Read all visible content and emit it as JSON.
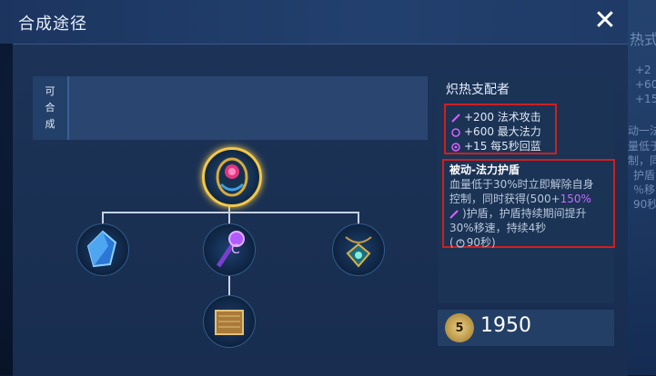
{
  "header": {
    "title": "合成途径",
    "close_symbol": "✕"
  },
  "craft": {
    "label": [
      "可",
      "合",
      "成"
    ]
  },
  "bg_text": {
    "right_top": "热式",
    "right_nums": [
      "+2",
      "+60",
      "+15"
    ],
    "right_mid": [
      "动一法",
      "量低于",
      "制，同",
      "护盾",
      "％移",
      "90秒"
    ]
  },
  "item": {
    "name": "炽热支配者",
    "stats": [
      "+200 法术攻击",
      "+600 最大法力",
      "+15 每5秒回蓝"
    ],
    "passive_title": "被动-法力护盾",
    "passive_lines": [
      "血量低于30%时立即解除自身",
      "控制，同时获得(500+",
      "150%",
      ")护盾，护盾持续期间提升",
      "30%移速，持续4秒",
      "(",
      "90秒)"
    ],
    "price": "1950",
    "coin_symbol": "5"
  },
  "icons": {
    "center": "golden-amulet-icon",
    "left": "blue-crystal-icon",
    "middle": "purple-staff-icon",
    "right": "green-pendant-icon",
    "bottom": "book-icon"
  },
  "colors": {
    "accent": "#f1c84a",
    "highlight_box": "#d01f1f",
    "magic": "#c76bff"
  }
}
